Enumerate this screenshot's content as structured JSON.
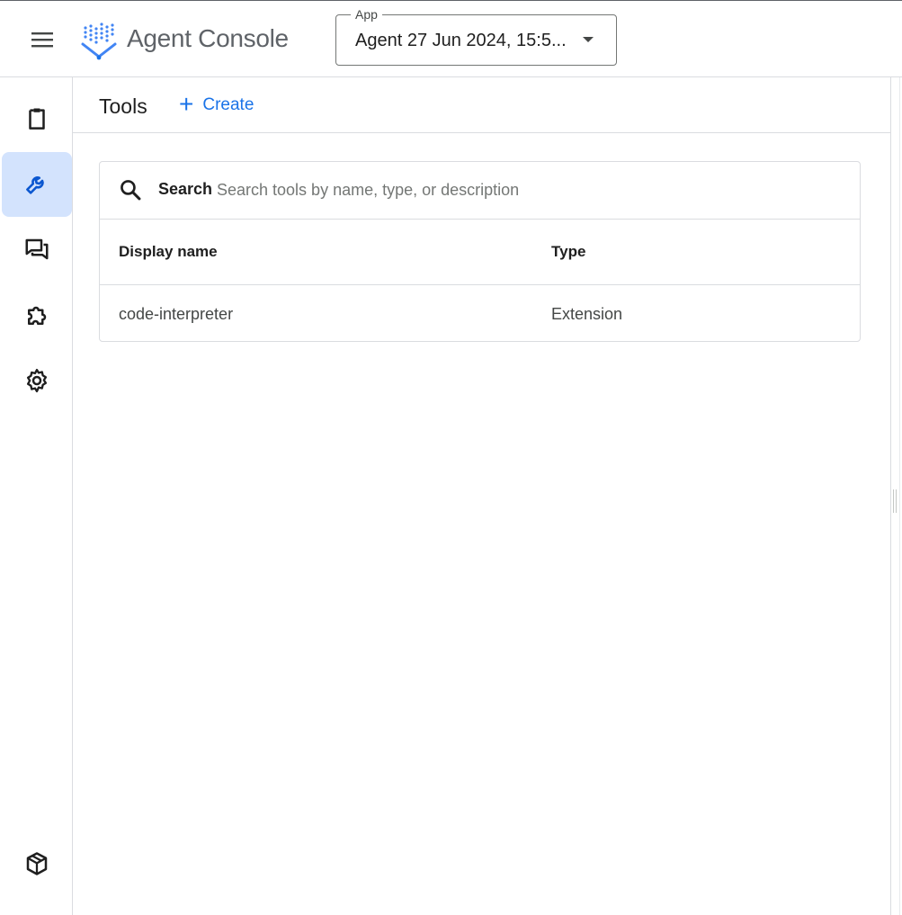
{
  "header": {
    "title": "Agent Console",
    "app_select": {
      "label": "App",
      "value": "Agent 27 Jun 2024, 15:5..."
    }
  },
  "rail": {
    "items": [
      {
        "icon": "clipboard-icon"
      },
      {
        "icon": "wrench-icon",
        "active": true
      },
      {
        "icon": "forum-icon"
      },
      {
        "icon": "extension-icon"
      },
      {
        "icon": "gear-icon"
      },
      {
        "icon": "deploy-box-icon"
      }
    ]
  },
  "page": {
    "title": "Tools",
    "create_label": "Create"
  },
  "table": {
    "search_label": "Search",
    "search_placeholder": "Search tools by name, type, or description",
    "columns": [
      "Display name",
      "Type"
    ],
    "rows": [
      {
        "display_name": "code-interpreter",
        "type": "Extension"
      }
    ]
  },
  "colors": {
    "accent": "#1a73e8",
    "active_rail_bg": "#d3e3fd",
    "border": "#dadce0"
  }
}
